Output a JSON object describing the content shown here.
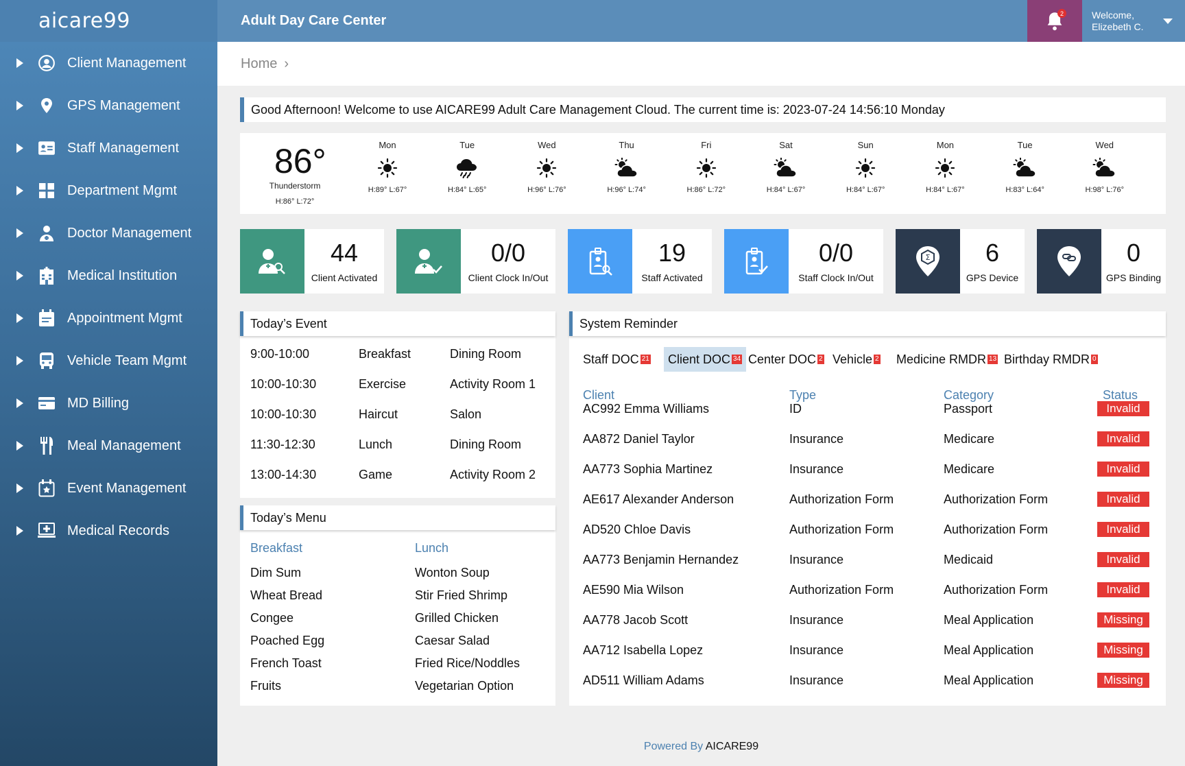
{
  "app": {
    "logo": "aicare99",
    "title": "Adult Day Care Center",
    "notifications": "2",
    "welcome_line1": "Welcome,",
    "welcome_line2": "Elizebeth C."
  },
  "sidebar": {
    "items": [
      {
        "label": "Client Management",
        "icon": "user-circle-icon"
      },
      {
        "label": "GPS Management",
        "icon": "map-pin-icon"
      },
      {
        "label": "Staff Management",
        "icon": "id-card-icon"
      },
      {
        "label": "Department Mgmt",
        "icon": "grid-icon"
      },
      {
        "label": "Doctor Management",
        "icon": "doctor-icon"
      },
      {
        "label": "Medical Institution",
        "icon": "hospital-icon"
      },
      {
        "label": "Appointment Mgmt",
        "icon": "calendar-icon"
      },
      {
        "label": "Vehicle Team Mgmt",
        "icon": "bus-icon"
      },
      {
        "label": "MD Billing",
        "icon": "credit-card-icon"
      },
      {
        "label": "Meal Management",
        "icon": "fork-knife-icon"
      },
      {
        "label": "Event Management",
        "icon": "calendar-star-icon"
      },
      {
        "label": "Medical Records",
        "icon": "medical-monitor-icon"
      }
    ]
  },
  "breadcrumb": {
    "home": "Home",
    "sep": "›"
  },
  "greeting": "Good Afternoon! Welcome to use AICARE99 Adult Care Management Cloud. The current time is: 2023-07-24 14:56:10 Monday",
  "weather": {
    "current": {
      "temp": "86°",
      "condition": "Thunderstorm",
      "hl": "H:86°  L:72°"
    },
    "days": [
      {
        "name": "Mon",
        "icon": "sun",
        "hl": "H:89°  L:67°"
      },
      {
        "name": "Tue",
        "icon": "rain",
        "hl": "H:84°  L:65°"
      },
      {
        "name": "Wed",
        "icon": "sun",
        "hl": "H:96°  L:76°"
      },
      {
        "name": "Thu",
        "icon": "partly-cloudy",
        "hl": "H:96°  L:74°"
      },
      {
        "name": "Fri",
        "icon": "sun",
        "hl": "H:86°  L:72°"
      },
      {
        "name": "Sat",
        "icon": "partly-cloudy",
        "hl": "H:84°  L:67°"
      },
      {
        "name": "Sun",
        "icon": "sun",
        "hl": "H:84°  L:67°"
      },
      {
        "name": "Mon",
        "icon": "sun",
        "hl": "H:84°  L:67°"
      },
      {
        "name": "Tue",
        "icon": "partly-cloudy",
        "hl": "H:83°  L:64°"
      },
      {
        "name": "Wed",
        "icon": "partly-cloudy",
        "hl": "H:98°  L:76°"
      }
    ]
  },
  "stats": [
    {
      "value": "44",
      "label": "Client Activated",
      "color": "#3f9780",
      "icon": "client-activated-icon"
    },
    {
      "value": "0/0",
      "label": "Client Clock In/Out",
      "color": "#3f9780",
      "icon": "client-clock-icon"
    },
    {
      "value": "19",
      "label": "Staff Activated",
      "color": "#4a9ff5",
      "icon": "staff-activated-icon"
    },
    {
      "value": "0/0",
      "label": "Staff Clock In/Out",
      "color": "#4a9ff5",
      "icon": "staff-clock-icon"
    },
    {
      "value": "6",
      "label": "GPS Device",
      "color": "#2b3a4e",
      "icon": "gps-device-icon"
    },
    {
      "value": "0",
      "label": "GPS Binding",
      "color": "#2b3a4e",
      "icon": "gps-binding-icon"
    }
  ],
  "events": {
    "title": "Today’s Event",
    "rows": [
      {
        "time": "9:00-10:00",
        "name": "Breakfast",
        "place": "Dining Room"
      },
      {
        "time": "10:00-10:30",
        "name": "Exercise",
        "place": "Activity Room 1"
      },
      {
        "time": "10:00-10:30",
        "name": "Haircut",
        "place": "Salon"
      },
      {
        "time": "11:30-12:30",
        "name": "Lunch",
        "place": "Dining Room"
      },
      {
        "time": "13:00-14:30",
        "name": "Game",
        "place": "Activity Room 2"
      }
    ]
  },
  "menu": {
    "title": "Today’s Menu",
    "breakfast_label": "Breakfast",
    "lunch_label": "Lunch",
    "breakfast": [
      "Dim Sum",
      "Wheat Bread",
      "Congee",
      "Poached Egg",
      "French Toast",
      "Fruits"
    ],
    "lunch": [
      "Wonton Soup",
      "Stir Fried Shrimp",
      "Grilled Chicken",
      "Caesar Salad",
      "Fried Rice/Noddles",
      "Vegetarian Option"
    ]
  },
  "reminder": {
    "title": "System Reminder",
    "tabs": [
      {
        "label": "Staff DOC",
        "count": "21"
      },
      {
        "label": "Client DOC",
        "count": "34",
        "active": true
      },
      {
        "label": "Center DOC",
        "count": "2"
      },
      {
        "label": "Vehicle",
        "count": "2"
      },
      {
        "label": "Medicine RMDR",
        "count": "13"
      },
      {
        "label": "Birthday RMDR",
        "count": "0"
      }
    ],
    "headers": {
      "client": "Client",
      "type": "Type",
      "category": "Category",
      "status": "Status"
    },
    "rows": [
      {
        "client": "AC992 Emma Williams",
        "type": "ID",
        "category": "Passport",
        "status": "Invalid"
      },
      {
        "client": "AA872 Daniel Taylor",
        "type": "Insurance",
        "category": "Medicare",
        "status": "Invalid"
      },
      {
        "client": "AA773 Sophia Martinez",
        "type": "Insurance",
        "category": "Medicare",
        "status": "Invalid"
      },
      {
        "client": "AE617 Alexander Anderson",
        "type": "Authorization Form",
        "category": "Authorization Form",
        "status": "Invalid"
      },
      {
        "client": "AD520 Chloe Davis",
        "type": "Authorization Form",
        "category": "Authorization Form",
        "status": "Invalid"
      },
      {
        "client": "AA773 Benjamin Hernandez",
        "type": "Insurance",
        "category": "Medicaid",
        "status": "Invalid"
      },
      {
        "client": "AE590 Mia Wilson",
        "type": "Authorization Form",
        "category": "Authorization Form",
        "status": "Invalid"
      },
      {
        "client": "AA778 Jacob Scott",
        "type": "Insurance",
        "category": "Meal Application",
        "status": "Missing"
      },
      {
        "client": "AA712 Isabella Lopez",
        "type": "Insurance",
        "category": "Meal Application",
        "status": "Missing"
      },
      {
        "client": "AD511 William Adams",
        "type": "Insurance",
        "category": "Meal Application",
        "status": "Missing"
      }
    ]
  },
  "footer": {
    "prefix": "Powered By ",
    "brand": "AICARE99"
  }
}
